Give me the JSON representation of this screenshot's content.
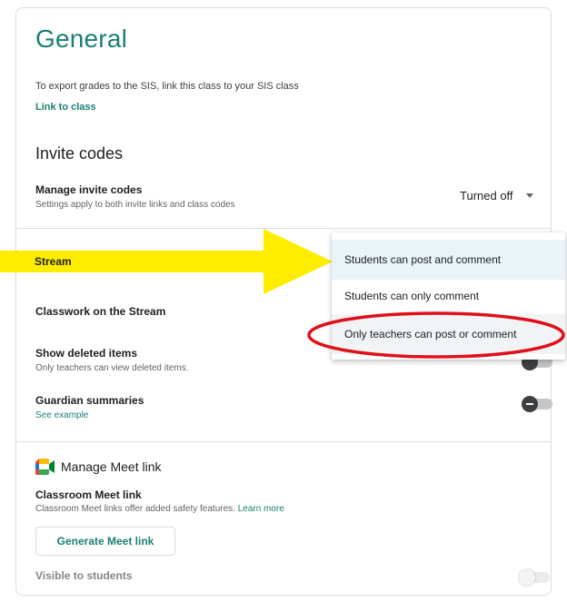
{
  "general": {
    "title": "General",
    "sis_text": "To export grades to the SIS, link this class to your SIS class",
    "link_to_class": "Link to class"
  },
  "invite_codes": {
    "title": "Invite codes",
    "manage_label": "Manage invite codes",
    "manage_sub": "Settings apply to both invite links and class codes",
    "selected_value": "Turned off"
  },
  "stream": {
    "label": "Stream",
    "classwork_label": "Classwork on the Stream",
    "deleted_label": "Show deleted items",
    "deleted_sub": "Only teachers can view deleted items.",
    "guardian_label": "Guardian summaries",
    "guardian_link": "See example"
  },
  "stream_dropdown": {
    "options": [
      "Students can post and comment",
      "Students can only comment",
      "Only teachers can post or comment"
    ],
    "selected_index": 0
  },
  "meet": {
    "title": "Manage Meet link",
    "classroom_label": "Classroom Meet link",
    "classroom_sub": "Classroom Meet links offer added safety features.",
    "learn_more": "Learn more",
    "generate_button": "Generate Meet link",
    "visible_label": "Visible to students"
  },
  "colors": {
    "accent": "#1a7f75",
    "annotation_arrow": "#ffed00",
    "annotation_circle": "#e0101a"
  },
  "icons": {
    "meet": "google-meet-icon",
    "caret": "caret-down-icon"
  }
}
